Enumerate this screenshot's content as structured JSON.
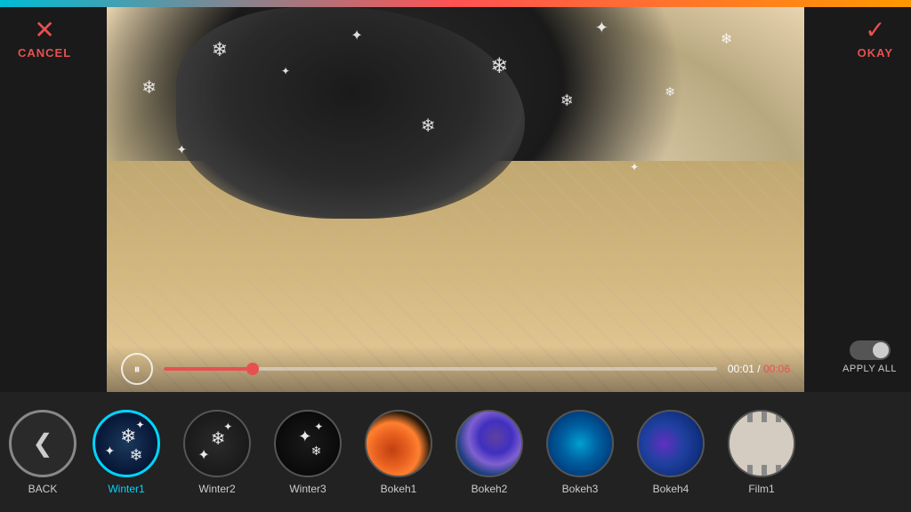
{
  "topbar": {
    "colors": [
      "#00bcd4",
      "#ff5252",
      "#ff9800"
    ]
  },
  "cancel": {
    "label": "CANCEL",
    "icon": "✕"
  },
  "okay": {
    "label": "OKAY",
    "icon": "✓"
  },
  "video": {
    "current_time": "00:01",
    "total_time": "00:06",
    "time_display": "00:01 / 00:06",
    "progress_percent": 16
  },
  "apply_all": {
    "label": "APPLY ALL",
    "enabled": false
  },
  "back": {
    "label": "BACK"
  },
  "filters": [
    {
      "id": "winter1",
      "label": "Winter1",
      "active": true
    },
    {
      "id": "winter2",
      "label": "Winter2",
      "active": false
    },
    {
      "id": "winter3",
      "label": "Winter3",
      "active": false
    },
    {
      "id": "bokeh1",
      "label": "Bokeh1",
      "active": false
    },
    {
      "id": "bokeh2",
      "label": "Bokeh2",
      "active": false
    },
    {
      "id": "bokeh3",
      "label": "Bokeh3",
      "active": false
    },
    {
      "id": "bokeh4",
      "label": "Bokeh4",
      "active": false
    },
    {
      "id": "film1",
      "label": "Film1",
      "active": false
    }
  ]
}
